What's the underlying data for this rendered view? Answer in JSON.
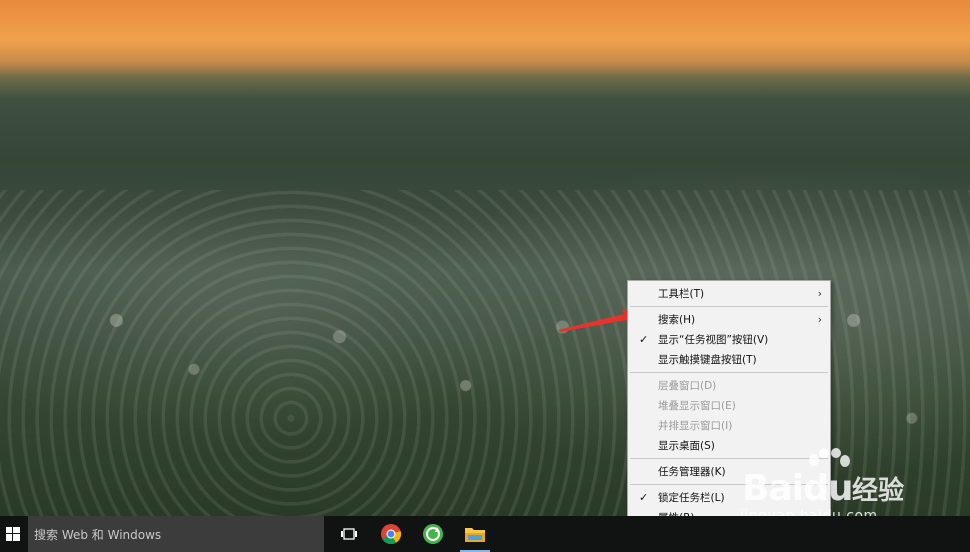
{
  "taskbar": {
    "search_placeholder": "搜索 Web 和 Windows",
    "pinned": [
      {
        "name": "task-view",
        "icon": "task-view-icon"
      },
      {
        "name": "chrome",
        "icon": "chrome-icon"
      },
      {
        "name": "update-app",
        "icon": "green-circle-icon"
      },
      {
        "name": "file-explorer",
        "icon": "folder-icon"
      }
    ]
  },
  "context_menu": {
    "items": {
      "toolbars": "工具栏(T)",
      "search": "搜索(H)",
      "show_task_view": "显示“任务视图”按钮(V)",
      "show_touch_keyboard": "显示触摸键盘按钮(T)",
      "cascade": "层叠窗口(D)",
      "stack": "堆叠显示窗口(E)",
      "side_by_side": "并排显示窗口(I)",
      "show_desktop": "显示桌面(S)",
      "task_manager": "任务管理器(K)",
      "lock_taskbar": "锁定任务栏(L)",
      "properties": "属性(R)"
    },
    "checked": [
      "show_task_view",
      "lock_taskbar"
    ],
    "disabled": [
      "cascade",
      "stack",
      "side_by_side"
    ],
    "submenu": [
      "toolbars",
      "search"
    ]
  },
  "watermark": {
    "logo": "Baidu",
    "brand_cn": "经验",
    "url": "jingyan.baidu.com"
  },
  "colors": {
    "taskbar_bg": "#111313",
    "search_bg": "#3c3c3c",
    "menu_bg": "#f2f2f2",
    "arrow": "#e8332d",
    "active_indicator": "#7fb7e8"
  }
}
